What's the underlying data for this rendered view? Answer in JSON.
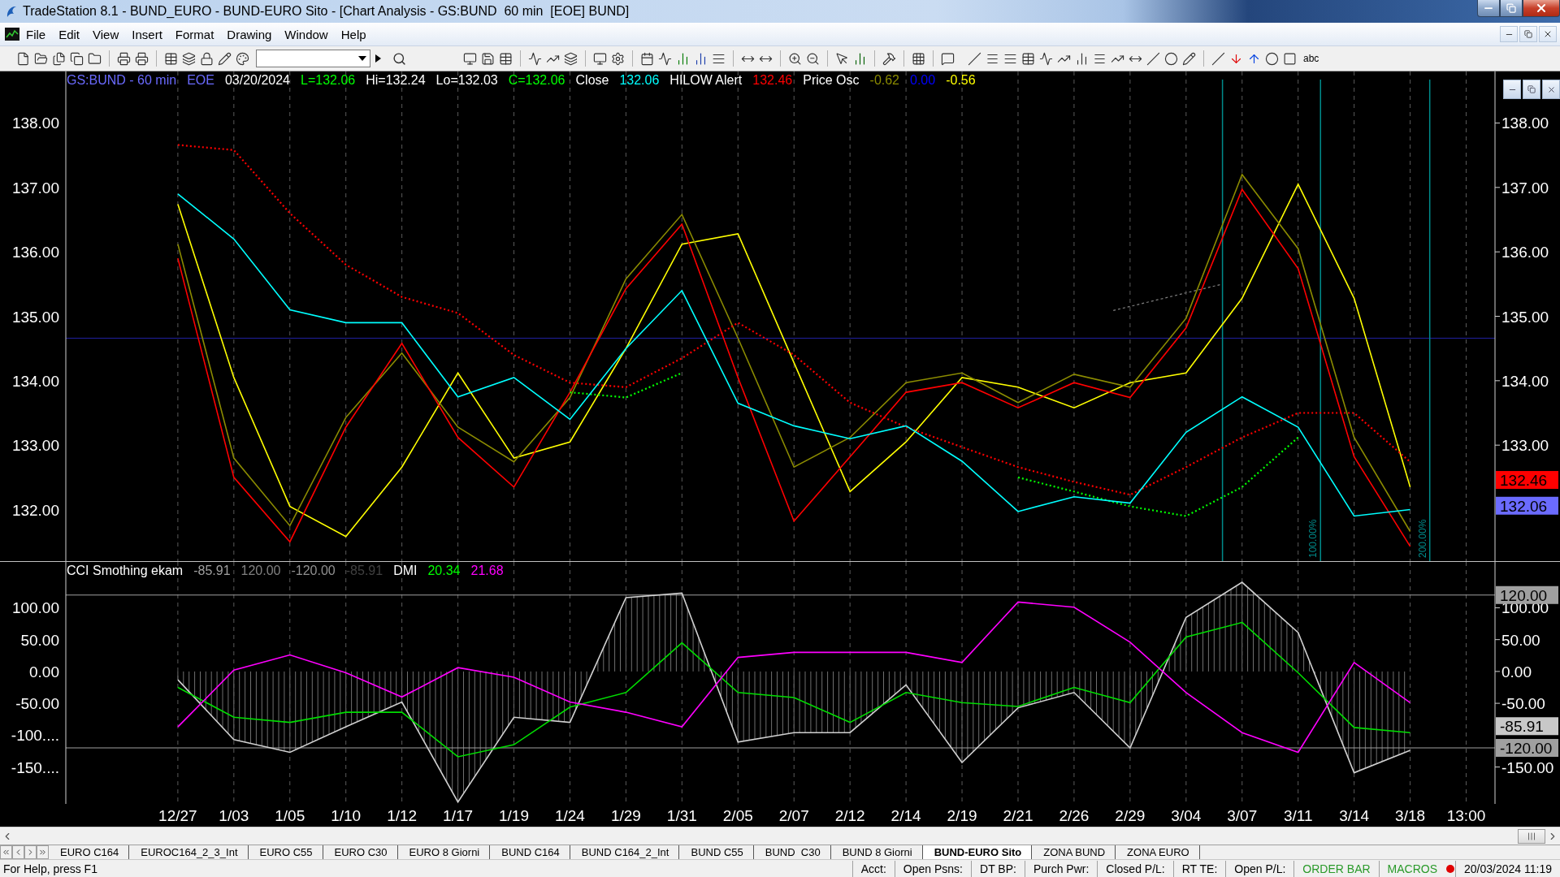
{
  "window": {
    "title": "TradeStation 8.1 - BUND_EURO - BUND-EURO Sito - [Chart Analysis - GS:BUND  60 min  [EOE] BUND]"
  },
  "menu": [
    "File",
    "Edit",
    "View",
    "Insert",
    "Format",
    "Drawing",
    "Window",
    "Help"
  ],
  "toolbar": {
    "text_tool": "abc"
  },
  "price_pane": {
    "header": [
      {
        "text": "GS:BUND - 60 min",
        "color": "#6a6aff"
      },
      {
        "text": "EOE",
        "color": "#6a6aff"
      },
      {
        "text": "03/20/2024",
        "color": "#ffffff"
      },
      {
        "text": "L=132.06",
        "color": "#00ff00"
      },
      {
        "text": "Hi=132.24",
        "color": "#ffffff"
      },
      {
        "text": "Lo=132.03",
        "color": "#ffffff"
      },
      {
        "text": "C=132.06",
        "color": "#00ff00"
      },
      {
        "text": "Close",
        "color": "#ffffff"
      },
      {
        "text": "132.06",
        "color": "#00ffff"
      },
      {
        "text": "HILOW Alert",
        "color": "#ffffff"
      },
      {
        "text": "132.46",
        "color": "#ff0000"
      },
      {
        "text": "Price Osc",
        "color": "#ffffff"
      },
      {
        "text": "-0.62",
        "color": "#8b8b00"
      },
      {
        "text": "0.00",
        "color": "#0000ff"
      },
      {
        "text": "-0.56",
        "color": "#ffff00"
      }
    ],
    "right_axis": [
      "138.00",
      "137.00",
      "136.00",
      "135.00",
      "134.00",
      "133.00"
    ],
    "markers": [
      "100.00%",
      "200.00%"
    ],
    "chart_data": {
      "type": "line",
      "grid": true,
      "ylim": [
        131.2,
        138.8
      ],
      "yticks": [
        {
          "value": 138,
          "label": "138.00"
        },
        {
          "value": 137,
          "label": "137.00"
        },
        {
          "value": 136,
          "label": "136.00"
        },
        {
          "value": 135,
          "label": "135.00"
        },
        {
          "value": 134,
          "label": "134.00"
        },
        {
          "value": 133,
          "label": "133.00"
        },
        {
          "value": 132,
          "label": "132.00"
        }
      ],
      "series": [
        {
          "color": "#ffff00",
          "values": [
            136.74,
            134.05,
            132.05,
            131.58,
            132.66,
            134.12,
            132.8,
            133.05,
            134.5,
            136.12,
            136.28,
            134.28,
            132.28,
            133.05,
            134.05,
            133.9,
            133.58,
            133.97,
            134.12,
            135.28,
            137.05,
            135.28,
            132.35,
            null
          ]
        },
        {
          "color": "#8b8b00",
          "values": [
            136.12,
            132.8,
            131.75,
            133.43,
            134.43,
            133.28,
            132.74,
            133.74,
            135.58,
            136.58,
            134.66,
            132.66,
            133.12,
            133.97,
            134.12,
            133.66,
            134.1,
            133.9,
            134.97,
            137.2,
            136.05,
            133.12,
            131.66,
            null
          ]
        },
        {
          "color": "#ff0000",
          "values": [
            135.9,
            132.5,
            131.5,
            133.28,
            134.58,
            133.12,
            132.35,
            133.82,
            135.43,
            136.43,
            134.05,
            131.82,
            132.82,
            133.82,
            133.97,
            133.58,
            133.97,
            133.74,
            134.82,
            136.97,
            135.74,
            132.82,
            131.43,
            null
          ]
        },
        {
          "color": "#ff0000",
          "line_style": "dotted",
          "values": [
            137.66,
            137.58,
            136.6,
            135.8,
            135.3,
            135.05,
            134.4,
            133.97,
            133.9,
            134.35,
            134.9,
            134.4,
            133.66,
            133.28,
            132.97,
            132.66,
            132.43,
            132.23,
            132.66,
            133.12,
            133.5,
            133.5,
            132.74,
            null
          ]
        },
        {
          "color": "#00ff00",
          "line_style": "dotted",
          "values": [
            null,
            null,
            null,
            null,
            null,
            null,
            null,
            133.82,
            133.74,
            134.12,
            null,
            null,
            null,
            null,
            null,
            132.5,
            132.28,
            132.05,
            131.9,
            132.35,
            133.12,
            null,
            null,
            null
          ]
        },
        {
          "color": "#00ffff",
          "values": [
            136.9,
            136.2,
            135.1,
            134.9,
            134.9,
            133.75,
            134.05,
            133.4,
            134.5,
            135.4,
            133.65,
            133.3,
            133.1,
            133.3,
            132.75,
            131.97,
            132.2,
            132.1,
            133.2,
            133.75,
            133.28,
            131.9,
            132.0,
            null
          ]
        }
      ],
      "ref_lines": [
        {
          "axis": "y",
          "value": 134.66
        }
      ]
    },
    "value_tags": [
      {
        "text": "132.46",
        "color": "#ff0000"
      },
      {
        "text": "132.06",
        "color": "#6b6bff"
      }
    ]
  },
  "oscillator_pane": {
    "header": [
      {
        "text": "CCI Smothing ekam",
        "color": "#ffffff"
      },
      {
        "text": "-85.91",
        "color": "#a0a0a0"
      },
      {
        "text": "120.00",
        "color": "#808080"
      },
      {
        "text": "-120.00",
        "color": "#909090"
      },
      {
        "text": "-85.91",
        "color": "#404040"
      },
      {
        "text": "DMI",
        "color": "#ffffff"
      },
      {
        "text": "20.34",
        "color": "#00ff00"
      },
      {
        "text": "21.68",
        "color": "#ff00ff"
      }
    ],
    "right_axis": [
      "100.00",
      "50.00",
      "0.00",
      "-50.00",
      "-150.00"
    ],
    "chart_data": {
      "type": "line",
      "grid": true,
      "categories": [
        "12/27",
        "1/03",
        "1/05",
        "1/10",
        "1/12",
        "1/17",
        "1/19",
        "1/24",
        "1/29",
        "1/31",
        "2/05",
        "2/07",
        "2/12",
        "2/14",
        "2/19",
        "2/21",
        "2/26",
        "2/29",
        "3/04",
        "3/07",
        "3/11",
        "3/14",
        "3/18",
        "13:00"
      ],
      "ylim": [
        -208,
        172
      ],
      "yticks": [
        {
          "value": 100,
          "label": "100.00"
        },
        {
          "value": 50,
          "label": "50.00"
        },
        {
          "value": 0,
          "label": "0.00"
        },
        {
          "value": -50,
          "label": "-50.00"
        },
        {
          "value": -100,
          "label": "-100...."
        },
        {
          "value": -150,
          "label": "-150...."
        }
      ],
      "series": [
        {
          "color": "#d0d0d0",
          "values": [
            -13,
            -107,
            -127,
            -87,
            -48,
            -205,
            -72,
            -80,
            116,
            123,
            -111,
            -96,
            -96,
            -21,
            -143,
            -57,
            -33,
            -120,
            85,
            140,
            61,
            -159,
            -124,
            null
          ]
        },
        {
          "color": "#00dd00",
          "values": [
            -25,
            -72,
            -80,
            -64,
            -64,
            -134,
            -115,
            -56,
            -33,
            45,
            -33,
            -41,
            -80,
            -33,
            -49,
            -55,
            -25,
            -49,
            54,
            77,
            -2,
            -88,
            -96,
            null
          ]
        },
        {
          "color": "#ff00ff",
          "values": [
            -87,
            2,
            26,
            -2,
            -40,
            6,
            -9,
            -48,
            -64,
            -87,
            22,
            30,
            30,
            30,
            14,
            109,
            101,
            46,
            -33,
            -96,
            -127,
            14,
            -49,
            null
          ]
        }
      ],
      "ref_lines": [
        {
          "axis": "y",
          "value": 120
        },
        {
          "axis": "y",
          "value": -120
        }
      ]
    },
    "value_tags": [
      {
        "text": "120.00",
        "color": "#a0a0a0"
      },
      {
        "text": "-85.91",
        "color": "#c8c8c8"
      },
      {
        "text": "-120.00",
        "color": "#a0a0a0"
      }
    ]
  },
  "tabs": [
    {
      "label": "EURO C164",
      "selected": false
    },
    {
      "label": "EUROC164_2_3_Int",
      "selected": false
    },
    {
      "label": "EURO C55",
      "selected": false
    },
    {
      "label": "EURO C30",
      "selected": false
    },
    {
      "label": "EURO 8 Giorni",
      "selected": false
    },
    {
      "label": "BUND C164",
      "selected": false
    },
    {
      "label": "BUND C164_2_Int",
      "selected": false
    },
    {
      "label": "BUND C55",
      "selected": false
    },
    {
      "label": "BUND  C30",
      "selected": false
    },
    {
      "label": "BUND 8 Giorni",
      "selected": false
    },
    {
      "label": "BUND-EURO Sito",
      "selected": true
    },
    {
      "label": "ZONA BUND",
      "selected": false
    },
    {
      "label": "ZONA EURO",
      "selected": false
    }
  ],
  "status_bar": {
    "help": "For Help, press F1",
    "fields": [
      "Acct:",
      "Open Psns:",
      "DT BP:",
      "Purch Pwr:",
      "Closed P/L:",
      "RT TE:",
      "Open P/L:"
    ],
    "indicators": [
      "ORDER BAR",
      "MACROS"
    ],
    "clock": "20/03/2024 11:19"
  }
}
